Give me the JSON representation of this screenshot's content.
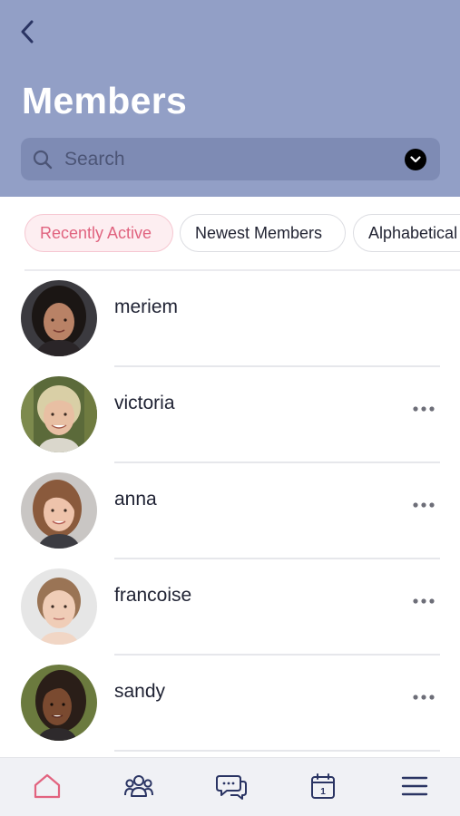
{
  "header": {
    "title": "Members",
    "background_color": "#929fc6",
    "back_icon": "chevron-left-icon"
  },
  "search": {
    "placeholder": "Search",
    "value": "",
    "icon": "search-icon",
    "filter_icon": "chevron-down-circle-icon"
  },
  "tabs": [
    {
      "label": "Recently Active",
      "active": true
    },
    {
      "label": "Newest Members",
      "active": false
    },
    {
      "label": "Alphabetical",
      "active": false
    }
  ],
  "members": [
    {
      "name": "meriem",
      "has_more": false,
      "avatar": "photo-woman-dark-hair"
    },
    {
      "name": "victoria",
      "has_more": true,
      "avatar": "photo-woman-blonde-short-hair"
    },
    {
      "name": "anna",
      "has_more": true,
      "avatar": "photo-woman-brown-hair"
    },
    {
      "name": "francoise",
      "has_more": true,
      "avatar": "photo-woman-pulled-back-hair"
    },
    {
      "name": "sandy",
      "has_more": true,
      "avatar": "photo-woman-braids"
    }
  ],
  "bottom_nav": [
    {
      "icon": "home-icon",
      "active": true,
      "color": "#e2637f"
    },
    {
      "icon": "groups-icon",
      "active": false,
      "color": "#2a3463"
    },
    {
      "icon": "messages-icon",
      "active": false,
      "color": "#2a3463"
    },
    {
      "icon": "calendar-icon",
      "active": false,
      "color": "#2a3463",
      "badge_text": "1"
    },
    {
      "icon": "menu-icon",
      "active": false,
      "color": "#2a3463"
    }
  ],
  "colors": {
    "accent_pink": "#e0637f",
    "active_tab_bg": "#fdeef1",
    "nav_icon": "#2a3463"
  }
}
